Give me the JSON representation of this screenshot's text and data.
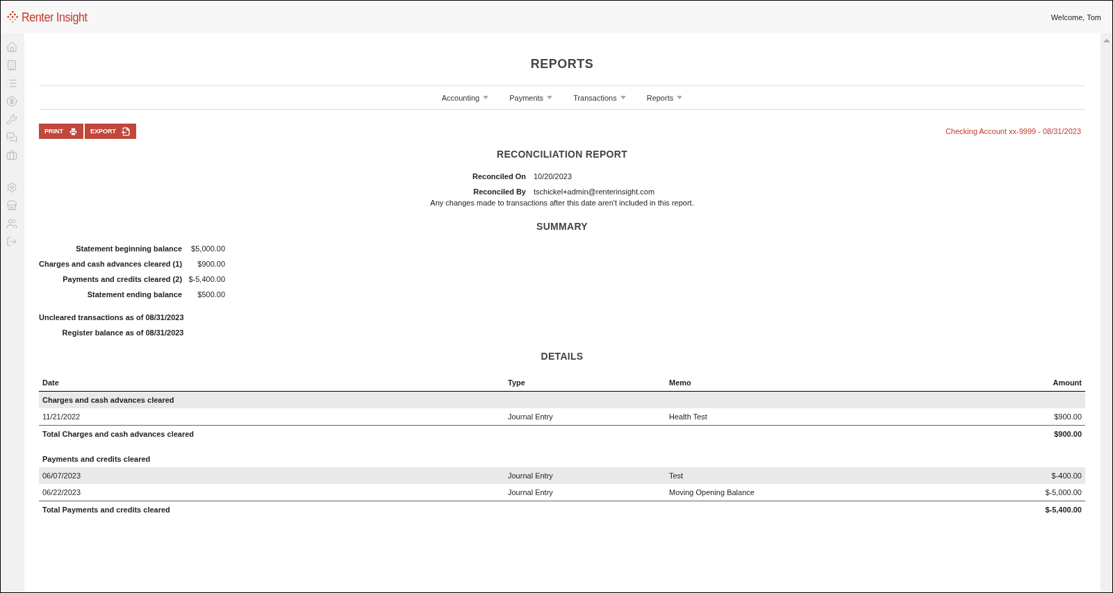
{
  "header": {
    "logo": "Renter Insight",
    "welcome": "Welcome, Tom"
  },
  "page_title": "REPORTS",
  "nav": [
    {
      "label": "Accounting"
    },
    {
      "label": "Payments"
    },
    {
      "label": "Transactions"
    },
    {
      "label": "Reports"
    }
  ],
  "actions": [
    {
      "label": "PRINT",
      "kind": "print"
    },
    {
      "label": "EXPORT",
      "kind": "export"
    }
  ],
  "account": "Checking Account xx-9999 - 08/31/2023",
  "report_title": "RECONCILIATION REPORT",
  "meta": [
    {
      "label": "Reconciled On",
      "value": "10/20/2023"
    },
    {
      "label": "Reconciled By",
      "value": "tschickel+admin@renterinsight.com"
    }
  ],
  "note": "Any changes made to transactions after this date aren't included in this report.",
  "summary_title": "SUMMARY",
  "summary": [
    {
      "label": "Statement beginning balance",
      "value": "$5,000.00"
    },
    {
      "label": "Charges and cash advances cleared (1)",
      "value": "$900.00"
    },
    {
      "label": "Payments and credits cleared (2)",
      "value": "$-5,400.00"
    },
    {
      "label": "Statement ending balance",
      "value": "$500.00"
    }
  ],
  "uncleared": [
    {
      "label": "Uncleared transactions as of 08/31/2023"
    },
    {
      "label": "Register balance as of 08/31/2023"
    }
  ],
  "details_title": "DETAILS",
  "table": {
    "columns": [
      "Date",
      "Type",
      "Memo",
      "Amount"
    ],
    "rows": [
      {
        "kind": "group",
        "label": "Charges and cash advances cleared",
        "shaded": true
      },
      {
        "kind": "entry",
        "cells": [
          "11/21/2022",
          "Journal Entry",
          "Health Test",
          "$900.00"
        ],
        "shaded": false
      },
      {
        "kind": "total",
        "label": "Total Charges and cash advances cleared",
        "amount": "$900.00"
      },
      {
        "kind": "group",
        "label": "Payments and credits cleared",
        "shaded": false
      },
      {
        "kind": "entry",
        "cells": [
          "06/07/2023",
          "Journal Entry",
          "Test",
          "$-400.00"
        ],
        "shaded": true
      },
      {
        "kind": "entry",
        "cells": [
          "06/22/2023",
          "Journal Entry",
          "Moving Opening Balance",
          "$-5,000.00"
        ],
        "shaded": false
      },
      {
        "kind": "total",
        "label": "Total Payments and credits cleared",
        "amount": "$-5,400.00"
      }
    ]
  }
}
